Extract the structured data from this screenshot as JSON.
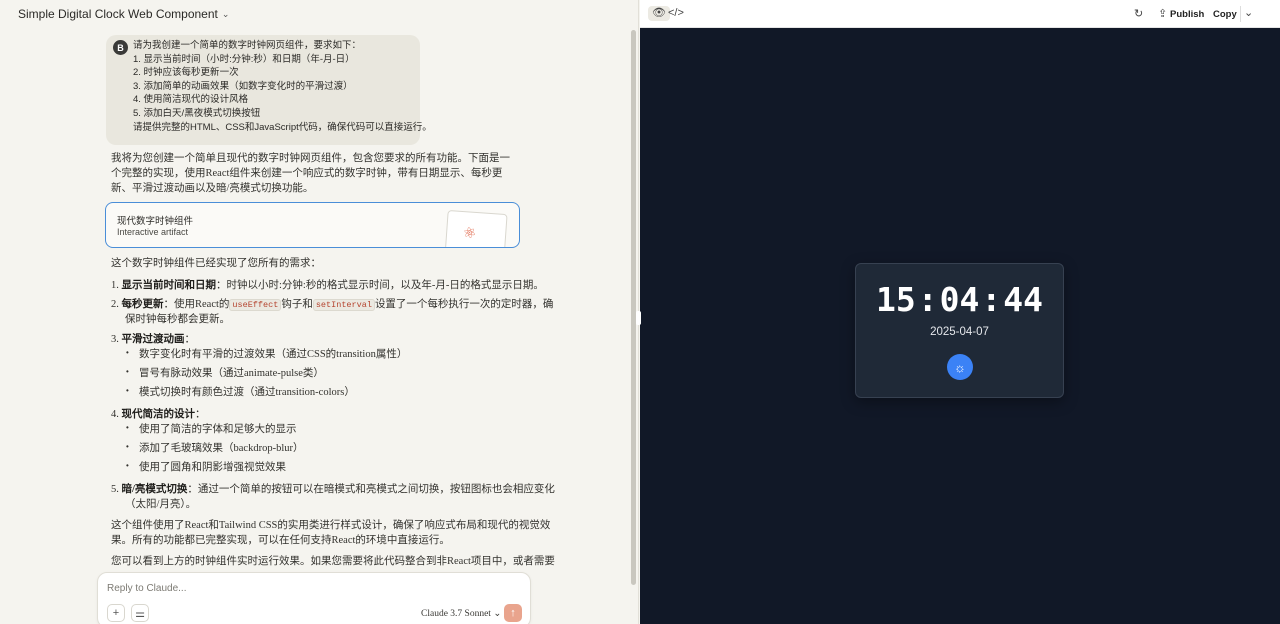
{
  "chat": {
    "title": "Simple Digital Clock Web Component",
    "user": {
      "avatar_initial": "B",
      "lines": [
        "请为我创建一个简单的数字时钟网页组件，要求如下：",
        "1. 显示当前时间（小时:分钟:秒）和日期（年-月-日）",
        "2. 时钟应该每秒更新一次",
        "3. 添加简单的动画效果（如数字变化时的平滑过渡）",
        "4. 使用简洁现代的设计风格",
        "5. 添加白天/黑夜模式切换按钮",
        "请提供完整的HTML、CSS和JavaScript代码，确保代码可以直接运行。"
      ]
    },
    "intro": "我将为您创建一个简单且现代的数字时钟网页组件，包含您要求的所有功能。下面是一个完整的实现，使用React组件来创建一个响应式的数字时钟，带有日期显示、每秒更新、平滑过渡动画以及暗/亮模式切换功能。",
    "artifact": {
      "title": "现代数字时钟组件",
      "subtitle": "Interactive artifact",
      "icon": "atom-icon"
    },
    "implemented": "这个数字时钟组件已经实现了您所有的需求：",
    "points": {
      "p1_title": "显示当前时间和日期",
      "p1_text": "：时钟以小时:分钟:秒的格式显示时间，以及年-月-日的格式显示日期。",
      "p2_title": "每秒更新",
      "p2_a": "：使用React的",
      "p2_code1": "useEffect",
      "p2_b": "钩子和",
      "p2_code2": "setInterval",
      "p2_c": "设置了一个每秒执行一次的定时器，确",
      "p2_d": "保时钟每秒都会更新。",
      "p3_title": "平滑过渡动画",
      "p3_items": [
        "数字变化时有平滑的过渡效果（通过CSS的transition属性）",
        "冒号有脉动效果（通过animate-pulse类）",
        "模式切换时有颜色过渡（通过transition-colors）"
      ],
      "p4_title": "现代简洁的设计",
      "p4_items": [
        "使用了简洁的字体和足够大的显示",
        "添加了毛玻璃效果（backdrop-blur）",
        "使用了圆角和阴影增强视觉效果"
      ],
      "p5_title": "暗/亮模式切换",
      "p5_a": "：通过一个简单的按钮可以在暗模式和亮模式之间切换，按钮图标也会相应变化",
      "p5_b": "（太阳/月亮）。"
    },
    "summary_1": "这个组件使用了React和Tailwind CSS的实用类进行样式设计，确保了响应式布局和现代的视觉效",
    "summary_2": "果。所有的功能都已完整实现，可以在任何支持React的环境中直接运行。",
    "closing": "您可以看到上方的时钟组件实时运行效果。如果您需要将此代码整合到非React项目中，或者需要",
    "reply": {
      "placeholder": "Reply to Claude...",
      "model": "Claude 3.7 Sonnet"
    }
  },
  "preview": {
    "toolbar": {
      "publish": "Publish",
      "copy": "Copy"
    },
    "clock": {
      "hours": "15",
      "minutes": "04",
      "seconds": "44",
      "separator": ":",
      "date": "2025-04-07",
      "mode_icon": "sun-icon"
    },
    "colors": {
      "preview_bg": "#111827",
      "card_bg": "#1f2937",
      "accent": "#3b82f6",
      "artifact_border": "#4a8ed8"
    }
  }
}
